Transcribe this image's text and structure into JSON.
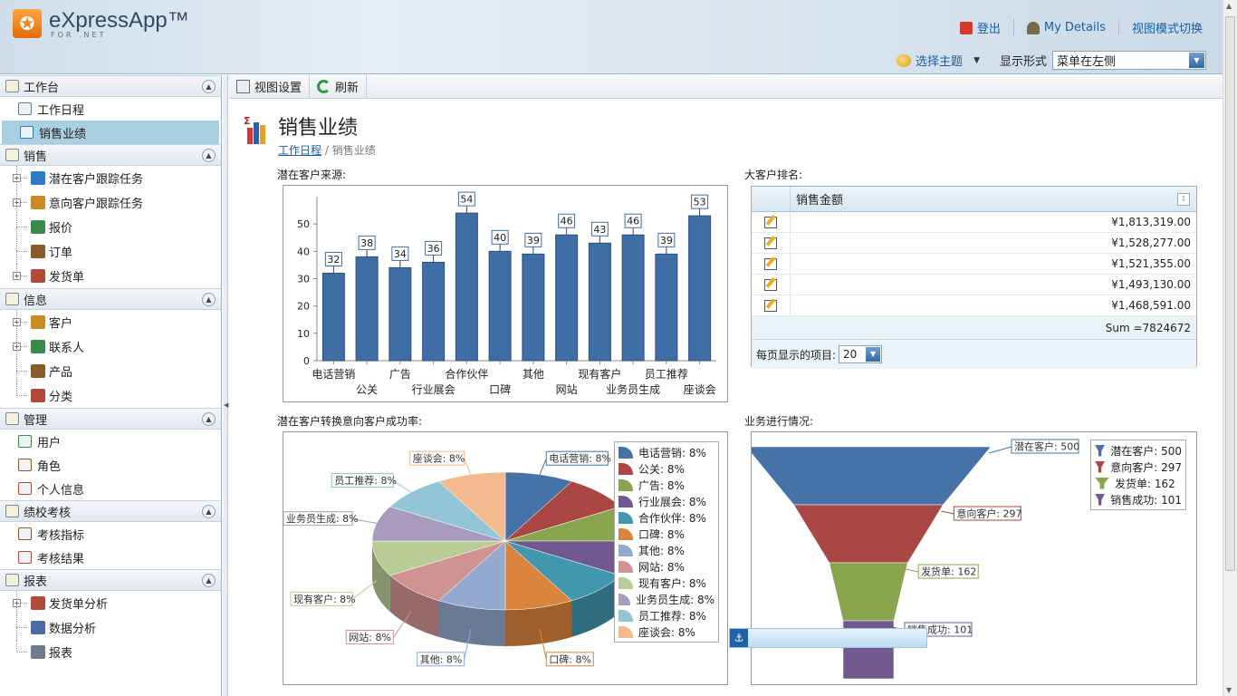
{
  "header": {
    "logo_letter": "✪",
    "app_name": "eXpressApp™",
    "app_sub": "FOR .NET",
    "links": [
      {
        "label": "登出",
        "icon": "logout-icon",
        "color": "#d23a2c"
      },
      {
        "label": "My Details",
        "icon": "user-details-icon",
        "color": "#7a6a4a"
      },
      {
        "label": "视图模式切换",
        "icon": "",
        "color": ""
      }
    ],
    "theme_label": "选择主题",
    "display_label": "显示形式",
    "display_value": "菜单在左侧"
  },
  "sidebar": {
    "groups": [
      {
        "label": "工作台",
        "items": [
          {
            "label": "工作日程",
            "type": "item"
          },
          {
            "label": "销售业绩",
            "type": "item",
            "selected": true
          }
        ]
      },
      {
        "label": "销售",
        "items": [
          {
            "label": "潜在客户跟踪任务",
            "type": "tree",
            "expandable": true
          },
          {
            "label": "意向客户跟踪任务",
            "type": "tree",
            "expandable": true
          },
          {
            "label": "报价",
            "type": "tree"
          },
          {
            "label": "订单",
            "type": "tree"
          },
          {
            "label": "发货单",
            "type": "tree",
            "expandable": true
          }
        ]
      },
      {
        "label": "信息",
        "items": [
          {
            "label": "客户",
            "type": "tree",
            "expandable": true
          },
          {
            "label": "联系人",
            "type": "tree",
            "expandable": true
          },
          {
            "label": "产品",
            "type": "tree"
          },
          {
            "label": "分类",
            "type": "tree"
          }
        ]
      },
      {
        "label": "管理",
        "items": [
          {
            "label": "用户",
            "type": "item"
          },
          {
            "label": "角色",
            "type": "item"
          },
          {
            "label": "个人信息",
            "type": "item"
          }
        ]
      },
      {
        "label": "绩校考核",
        "items": [
          {
            "label": "考核指标",
            "type": "item"
          },
          {
            "label": "考核结果",
            "type": "item"
          }
        ]
      },
      {
        "label": "报表",
        "items": [
          {
            "label": "发货单分析",
            "type": "tree",
            "expandable": true
          },
          {
            "label": "数据分析",
            "type": "tree"
          },
          {
            "label": "报表",
            "type": "tree"
          }
        ]
      }
    ]
  },
  "toolbar": {
    "view_settings": "视图设置",
    "refresh": "刷新"
  },
  "page": {
    "title": "销售业绩",
    "crumb_link": "工作日程",
    "crumb_sep": "/",
    "crumb_current": "销售业绩"
  },
  "sections": {
    "bar_title": "潜在客户来源:",
    "grid_title": "大客户排名:",
    "pie_title": "潜在客户转换意向客户成功率:",
    "funnel_title": "业务进行情况:"
  },
  "grid": {
    "column": "销售金额",
    "rows": [
      "¥1,813,319.00",
      "¥1,528,277.00",
      "¥1,521,355.00",
      "¥1,493,130.00",
      "¥1,468,591.00"
    ],
    "sum": "Sum =7824672",
    "pager_label": "每页显示的项目:",
    "pager_value": "20"
  },
  "chart_data": [
    {
      "type": "bar",
      "categories": [
        "电话营销",
        "公关",
        "广告",
        "行业展会",
        "合作伙伴",
        "口碑",
        "其他",
        "网站",
        "现有客户",
        "业务员生成",
        "员工推荐",
        "座谈会"
      ],
      "values": [
        32,
        38,
        34,
        36,
        54,
        40,
        39,
        46,
        43,
        46,
        39,
        53
      ],
      "ylim": [
        0,
        60
      ],
      "yticks": [
        0,
        10,
        20,
        30,
        40,
        50
      ],
      "color": "#3f6ea6"
    },
    {
      "type": "pie",
      "labels": [
        "电话营销",
        "公关",
        "广告",
        "行业展会",
        "合作伙伴",
        "口碑",
        "其他",
        "网站",
        "现有客户",
        "业务员生成",
        "员工推荐",
        "座谈会"
      ],
      "values": [
        8,
        8,
        8,
        8,
        8,
        8,
        8,
        8,
        8,
        8,
        8,
        8
      ],
      "legend": [
        "电话营销: 8%",
        "公关: 8%",
        "广告: 8%",
        "行业展会: 8%",
        "合作伙伴: 8%",
        "口碑: 8%",
        "其他: 8%",
        "网站: 8%",
        "现有客户: 8%",
        "业务员生成: 8%",
        "员工推荐: 8%",
        "座谈会: 8%"
      ],
      "colors": [
        "#4573a7",
        "#aa4643",
        "#89a54e",
        "#71588f",
        "#4198af",
        "#db843d",
        "#93a9cf",
        "#d19392",
        "#b9cd96",
        "#a99bbd",
        "#92c5d6",
        "#f5b98f"
      ]
    },
    {
      "type": "funnel",
      "labels": [
        "潜在客户",
        "意向客户",
        "发货单",
        "销售成功"
      ],
      "values": [
        500,
        297,
        162,
        101
      ],
      "legend": [
        "潜在客户: 500",
        "意向客户: 297",
        "发货单: 162",
        "销售成功: 101"
      ],
      "colors": [
        "#4573a7",
        "#aa4643",
        "#89a54e",
        "#71588f"
      ]
    }
  ]
}
